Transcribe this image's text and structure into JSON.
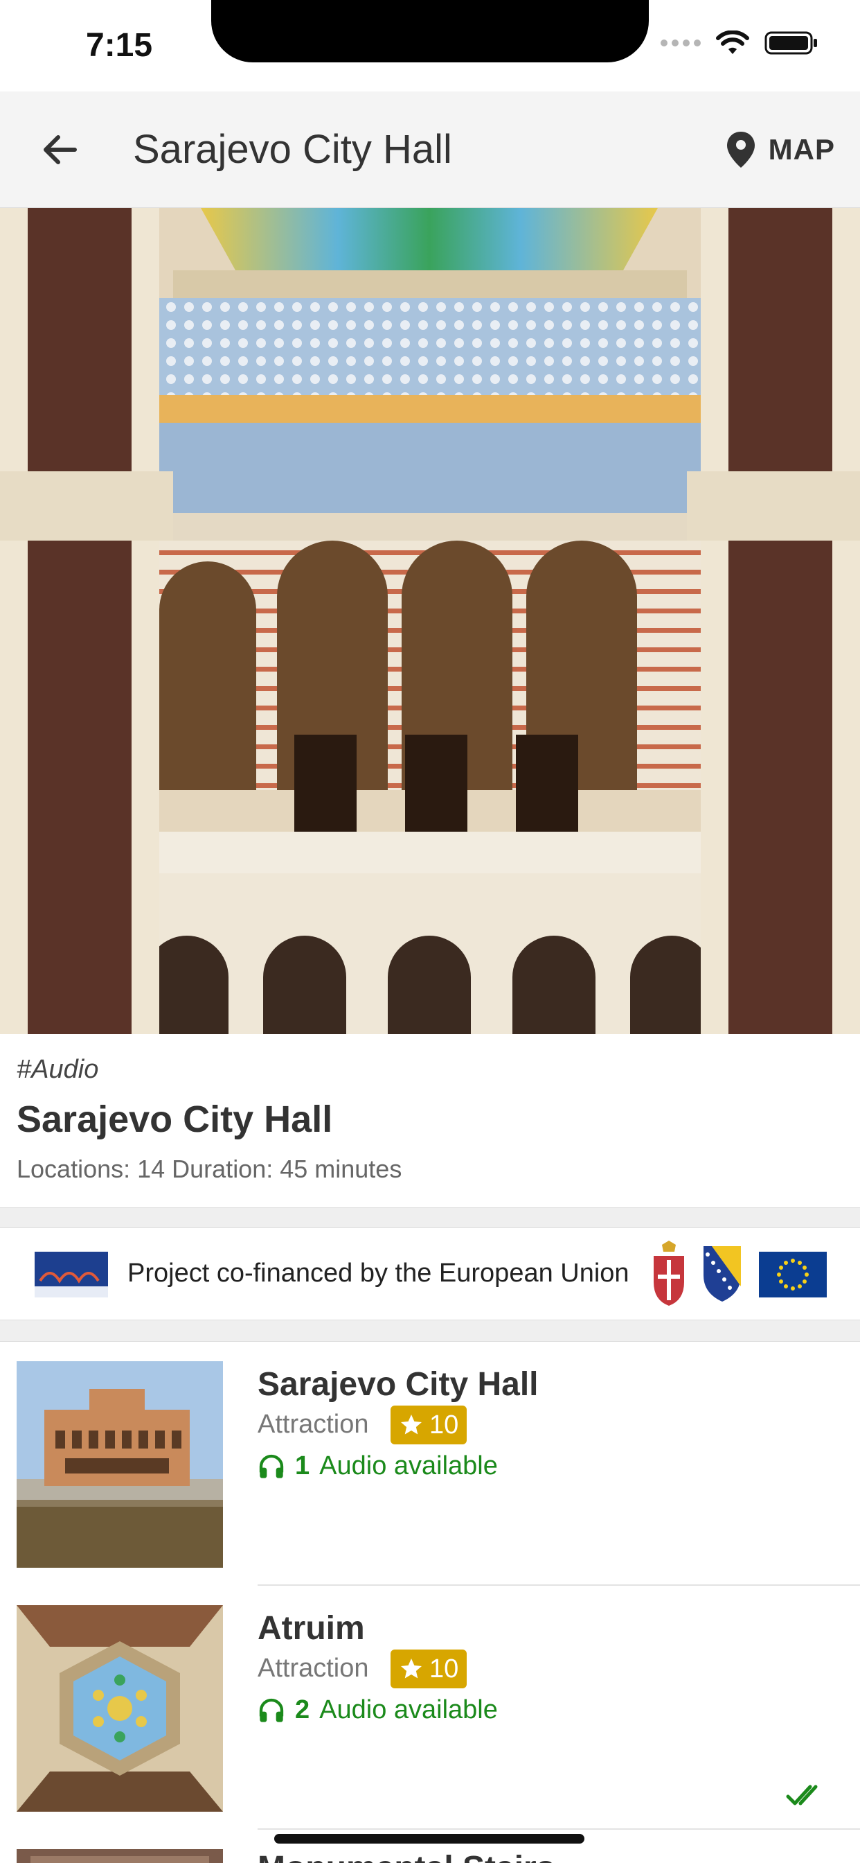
{
  "status": {
    "time": "7:15"
  },
  "toolbar": {
    "title": "Sarajevo City Hall",
    "map_label": "MAP"
  },
  "info": {
    "tag": "#Audio",
    "title": "Sarajevo City Hall",
    "meta": "Locations: 14 Duration: 45 minutes"
  },
  "banner": {
    "text": "Project co-financed by the European Union"
  },
  "items": [
    {
      "title": "Sarajevo City Hall",
      "category": "Attraction",
      "rating": "10",
      "audio_count": "1",
      "audio_label": "Audio available"
    },
    {
      "title": "Atruim",
      "category": "Attraction",
      "rating": "10",
      "audio_count": "2",
      "audio_label": "Audio available"
    },
    {
      "title": "Monumental Stairs"
    }
  ],
  "colors": {
    "rating_badge": "#d7a600",
    "audio_green": "#1b8a1b",
    "eu_blue": "#0b3d91"
  }
}
